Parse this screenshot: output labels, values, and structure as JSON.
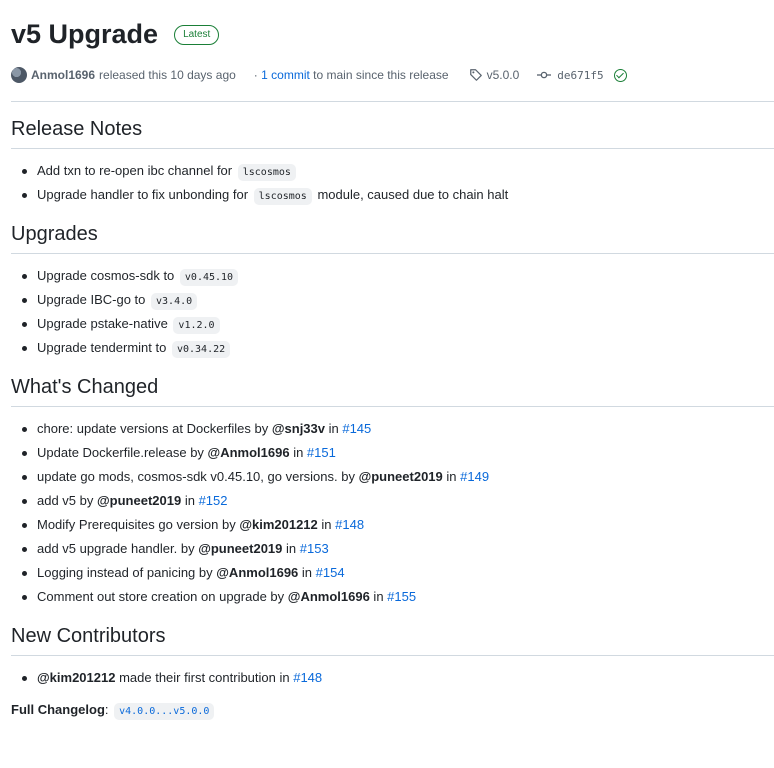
{
  "release": {
    "title": "v5 Upgrade",
    "badge": "Latest",
    "author": "Anmol1696",
    "released_text": "released this 10 days ago",
    "commits_link": "1 commit",
    "commits_rest": "to main since this release",
    "tag": "v5.0.0",
    "sha": "de671f5"
  },
  "sections": {
    "release_notes": {
      "heading": "Release Notes",
      "items": [
        {
          "pre": "Add txn to re-open ibc channel for ",
          "code": "lscosmos",
          "post": ""
        },
        {
          "pre": "Upgrade handler to fix unbonding for ",
          "code": "lscosmos",
          "post": " module, caused due to chain halt"
        }
      ]
    },
    "upgrades": {
      "heading": "Upgrades",
      "items": [
        {
          "pre": "Upgrade cosmos-sdk to ",
          "code": "v0.45.10"
        },
        {
          "pre": "Upgrade IBC-go to ",
          "code": "v3.4.0"
        },
        {
          "pre": "Upgrade pstake-native ",
          "code": "v1.2.0"
        },
        {
          "pre": "Upgrade tendermint to ",
          "code": "v0.34.22"
        }
      ]
    },
    "whats_changed": {
      "heading": "What's Changed",
      "items": [
        {
          "text": "chore: update versions at Dockerfiles by ",
          "user": "@snj33v",
          "in": " in ",
          "pr": "#145"
        },
        {
          "text": "Update Dockerfile.release by ",
          "user": "@Anmol1696",
          "in": " in ",
          "pr": "#151"
        },
        {
          "text": "update go mods, cosmos-sdk v0.45.10, go versions. by ",
          "user": "@puneet2019",
          "in": " in ",
          "pr": "#149"
        },
        {
          "text": "add v5 by ",
          "user": "@puneet2019",
          "in": " in ",
          "pr": "#152"
        },
        {
          "text": "Modify Prerequisites go version by ",
          "user": "@kim201212",
          "in": " in ",
          "pr": "#148"
        },
        {
          "text": "add v5 upgrade handler. by ",
          "user": "@puneet2019",
          "in": " in ",
          "pr": "#153"
        },
        {
          "text": "Logging instead of panicing by ",
          "user": "@Anmol1696",
          "in": " in ",
          "pr": "#154"
        },
        {
          "text": "Comment out store creation on upgrade by ",
          "user": "@Anmol1696",
          "in": " in ",
          "pr": "#155"
        }
      ]
    },
    "new_contributors": {
      "heading": "New Contributors",
      "items": [
        {
          "user": "@kim201212",
          "text": " made their first contribution in ",
          "pr": "#148"
        }
      ]
    }
  },
  "full_changelog": {
    "label": "Full Changelog",
    "link": "v4.0.0...v5.0.0"
  },
  "colors": {
    "link": "#0969da",
    "success": "#1a7f37",
    "muted": "#59636e"
  }
}
